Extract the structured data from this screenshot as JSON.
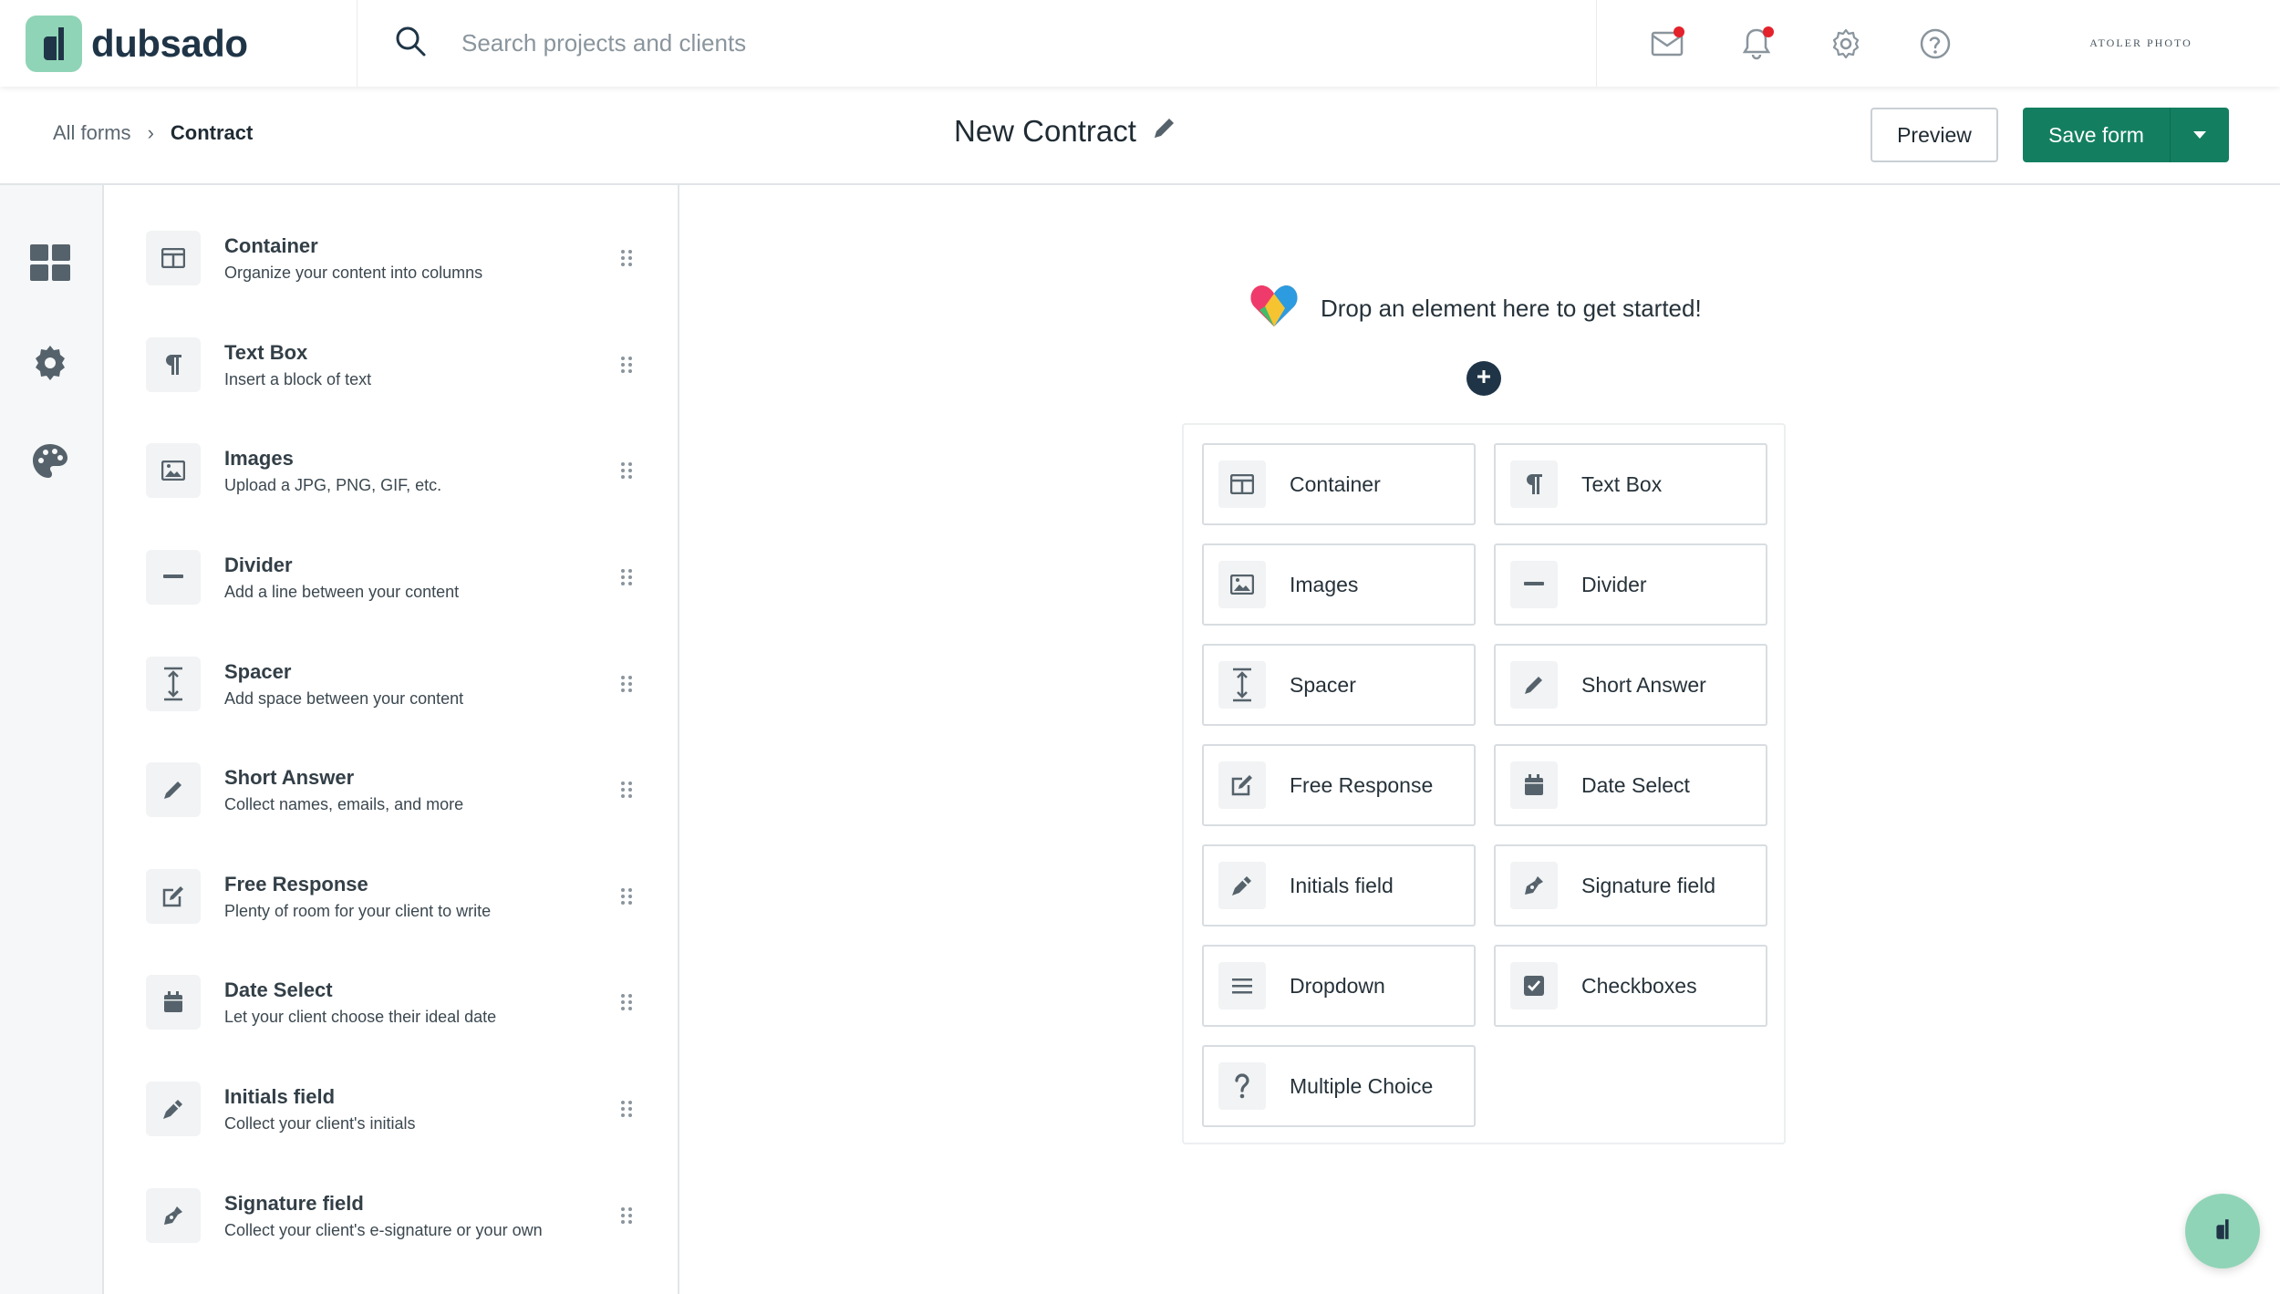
{
  "app": {
    "logo_text": "dubsado",
    "brand_text": "ATOLER PHOTO"
  },
  "search": {
    "placeholder": "Search projects and clients"
  },
  "breadcrumb": {
    "parent": "All forms",
    "current": "Contract"
  },
  "form": {
    "title": "New Contract"
  },
  "toolbar": {
    "preview_label": "Preview",
    "save_label": "Save form"
  },
  "icons": {
    "nav": [
      "mail-icon",
      "bell-icon",
      "gear-icon",
      "help-icon"
    ],
    "rail": [
      "elements-icon",
      "settings-icon",
      "palette-icon"
    ]
  },
  "colors": {
    "accent": "#137f60",
    "logo_bg": "#8fd4b6",
    "notification": "#e3222c",
    "dark": "#1f3547"
  },
  "elements_list": [
    {
      "title": "Container",
      "desc": "Organize your content into columns",
      "icon": "columns-icon"
    },
    {
      "title": "Text Box",
      "desc": "Insert a block of text",
      "icon": "paragraph-icon"
    },
    {
      "title": "Images",
      "desc": "Upload a JPG, PNG, GIF, etc.",
      "icon": "image-icon"
    },
    {
      "title": "Divider",
      "desc": "Add a line between your content",
      "icon": "minus-icon"
    },
    {
      "title": "Spacer",
      "desc": "Add space between your content",
      "icon": "spacer-icon"
    },
    {
      "title": "Short Answer",
      "desc": "Collect names, emails, and more",
      "icon": "pencil-icon"
    },
    {
      "title": "Free Response",
      "desc": "Plenty of room for your client to write",
      "icon": "edit-icon"
    },
    {
      "title": "Date Select",
      "desc": "Let your client choose their ideal date",
      "icon": "calendar-icon"
    },
    {
      "title": "Initials field",
      "desc": "Collect your client's initials",
      "icon": "pen-icon"
    },
    {
      "title": "Signature field",
      "desc": "Collect your client's e-signature or your own",
      "icon": "signature-icon"
    }
  ],
  "canvas": {
    "drop_message": "Drop an element here to get started!",
    "tiles": [
      {
        "label": "Container",
        "icon": "columns-icon"
      },
      {
        "label": "Text Box",
        "icon": "paragraph-icon"
      },
      {
        "label": "Images",
        "icon": "image-icon"
      },
      {
        "label": "Divider",
        "icon": "minus-icon"
      },
      {
        "label": "Spacer",
        "icon": "spacer-icon"
      },
      {
        "label": "Short Answer",
        "icon": "pencil-icon"
      },
      {
        "label": "Free Response",
        "icon": "edit-icon"
      },
      {
        "label": "Date Select",
        "icon": "calendar-icon"
      },
      {
        "label": "Initials field",
        "icon": "pen-icon"
      },
      {
        "label": "Signature field",
        "icon": "signature-icon"
      },
      {
        "label": "Dropdown",
        "icon": "list-icon"
      },
      {
        "label": "Checkboxes",
        "icon": "checkbox-icon"
      },
      {
        "label": "Multiple Choice",
        "icon": "question-icon"
      }
    ]
  }
}
